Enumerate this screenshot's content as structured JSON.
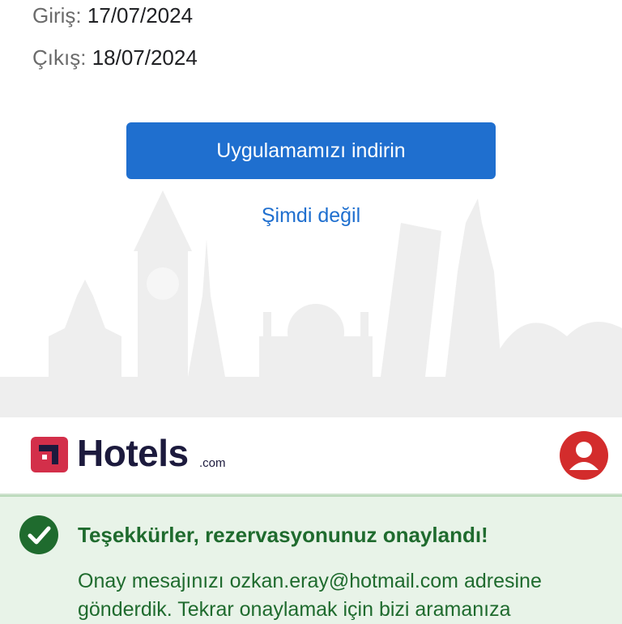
{
  "booking": {
    "checkin_label": "Giriş:",
    "checkin_date": "17/07/2024",
    "checkout_label": "Çıkış:",
    "checkout_date": "18/07/2024"
  },
  "app_promo": {
    "download_button": "Uygulamamızı indirin",
    "not_now_link": "Şimdi değil"
  },
  "header": {
    "logo_text": "Hotels",
    "logo_suffix": ".com",
    "brand_color": "#d32f4a",
    "avatar_icon": "user-icon"
  },
  "confirmation": {
    "icon": "check-circle-icon",
    "title": "Teşekkürler, rezervasyonunuz onaylandı!",
    "message": "Onay mesajınızı ozkan.eray@hotmail.com adresine gönderdik. Tekrar onaylamak için bizi aramanıza",
    "accent_color": "#1f6b2e"
  }
}
